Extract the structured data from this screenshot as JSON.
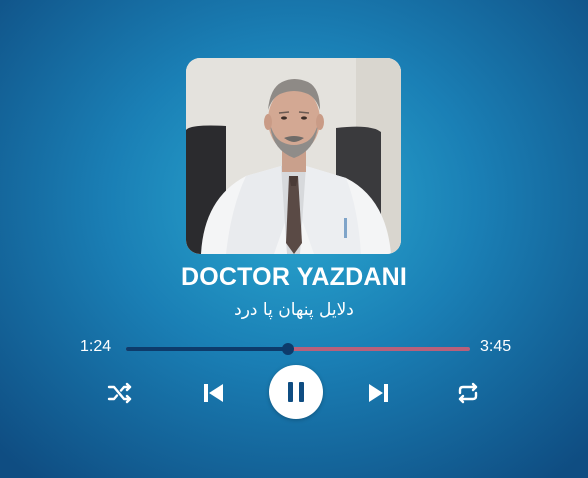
{
  "player": {
    "artist": "DOCTOR YAZDANI",
    "track_title": "دلایل پنهان پا درد",
    "current_time": "1:24",
    "total_time": "3:45",
    "progress_fraction": 0.47,
    "state": "playing"
  },
  "colors": {
    "bg_center": "#2aa8d0",
    "bg_edge": "#0f4d82",
    "progress_played": "#0d3b6b",
    "progress_remaining": "#b9607a",
    "icon": "#ffffff",
    "play_button_bg": "#ffffff",
    "pause_icon": "#0f4d82"
  },
  "controls": {
    "shuffle_icon": "shuffle-icon",
    "prev_icon": "skip-previous-icon",
    "play_pause_icon": "pause-icon",
    "next_icon": "skip-next-icon",
    "repeat_icon": "repeat-icon"
  }
}
